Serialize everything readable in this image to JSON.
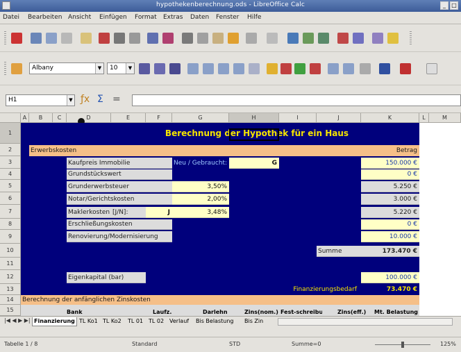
{
  "window": {
    "title": "hypothekenberechnung.ods - LibreOffice Calc"
  },
  "menu": [
    "Datei",
    "Bearbeiten",
    "Ansicht",
    "Einfügen",
    "Format",
    "Extras",
    "Daten",
    "Fenster",
    "Hilfe"
  ],
  "format_toolbar": {
    "font_name": "Albany",
    "font_size": "10"
  },
  "formula_bar": {
    "cell_ref": "H1",
    "sum_symbol": "Σ",
    "equals": "="
  },
  "columns": [
    "A",
    "B",
    "C",
    "D",
    "E",
    "F",
    "G",
    "H",
    "I",
    "J",
    "K",
    "L",
    "M"
  ],
  "rows": [
    "1",
    "2",
    "3",
    "4",
    "5",
    "6",
    "7",
    "8",
    "9",
    "10",
    "11",
    "12",
    "13",
    "14",
    "15"
  ],
  "sheet": {
    "title": "Berechnung der Hypothek für ein Haus",
    "section_erwerb": "Erwerbskosten",
    "betrag_header": "Betrag",
    "labels": {
      "kaufpreis": "Kaufpreis Immobilie",
      "grundstueck": "Grundstückswert",
      "grunderwerb": "Grunderwerbsteuer",
      "notar": "Notar/Gerichtskosten",
      "makler": "Maklerkosten",
      "makler_jn": "[J/N]:",
      "makler_flag": "J",
      "erschliessung": "Erschließungskosten",
      "renovierung": "Renovierung/Modernisierung",
      "neu_gebraucht": "Neu / Gebraucht:",
      "neu_gebraucht_val": "G",
      "summe": "Summe",
      "eigenkapital": "Eigenkapital (bar)",
      "finanzierungsbedarf": "Finanzierungsbedarf"
    },
    "percents": {
      "grunderwerb": "3,50%",
      "notar": "2,00%",
      "makler": "3,48%"
    },
    "amounts": {
      "kaufpreis": "150.000 €",
      "grundstueck": "0 €",
      "grunderwerb": "5.250 €",
      "notar": "3.000 €",
      "makler": "5.220 €",
      "erschliessung": "0 €",
      "renovierung": "10.000 €",
      "summe": "173.470 €",
      "eigenkapital": "100.000 €",
      "finanzierungsbedarf": "73.470 €"
    },
    "section_zins": "Berechnung der anfänglichen Zinskosten",
    "zins_headers": [
      "Bank",
      "Laufz.",
      "Darlehn",
      "Zins(nom.)",
      "Fest-schreibung",
      "Zins(eff.)",
      "Mt. Belastung"
    ]
  },
  "tabs": [
    "Finanzierung",
    "TL Ko1",
    "TL Ko2",
    "TL 01",
    "TL 02",
    "Verlauf",
    "Bis Belastung",
    "Bis Zin"
  ],
  "status": {
    "sheet": "Tabelle 1 / 8",
    "style": "Standard",
    "mode": "STD",
    "sum": "Summe=0",
    "zoom": "125%"
  },
  "colors": {
    "navy": "#00007c",
    "label_gray": "#dcdcdc",
    "input_yellow": "#ffffc6",
    "header_orange": "#f5bf88",
    "title_yellow": "#f5e400"
  }
}
